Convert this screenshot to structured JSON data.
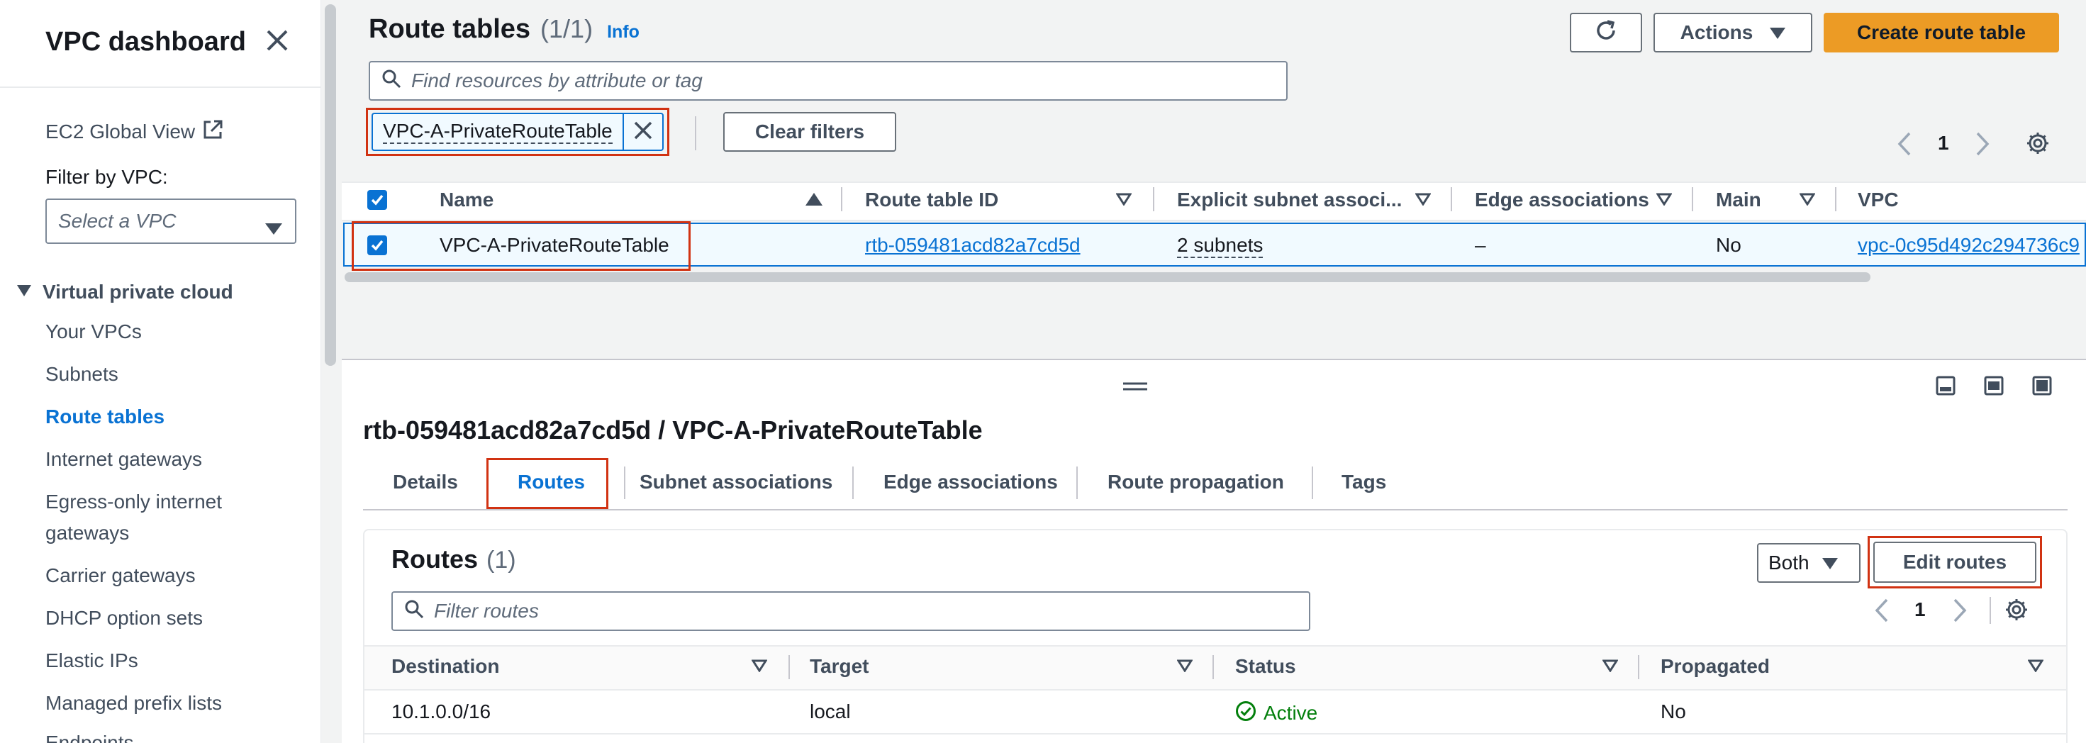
{
  "sidebar": {
    "title": "VPC dashboard",
    "ec2_global_view": "EC2 Global View",
    "filter_label": "Filter by VPC:",
    "filter_placeholder": "Select a VPC",
    "section_title": "Virtual private cloud",
    "items": [
      {
        "label": "Your VPCs"
      },
      {
        "label": "Subnets"
      },
      {
        "label": "Route tables",
        "active": true
      },
      {
        "label": "Internet gateways"
      },
      {
        "label": "Egress-only internet"
      },
      {
        "label": "gateways"
      },
      {
        "label": "Carrier gateways"
      },
      {
        "label": "DHCP option sets"
      },
      {
        "label": "Elastic IPs"
      },
      {
        "label": "Managed prefix lists"
      },
      {
        "label": "Endpoints"
      }
    ]
  },
  "header": {
    "title": "Route tables",
    "count": "(1/1)",
    "info": "Info",
    "actions_label": "Actions",
    "create_label": "Create route table"
  },
  "search": {
    "placeholder": "Find resources by attribute or tag",
    "filter_token": "VPC-A-PrivateRouteTable",
    "clear_filters": "Clear filters",
    "page": "1"
  },
  "table": {
    "columns": [
      "Name",
      "Route table ID",
      "Explicit subnet associ...",
      "Edge associations",
      "Main",
      "VPC"
    ],
    "row": {
      "name": "VPC-A-PrivateRouteTable",
      "route_table_id": "rtb-059481acd82a7cd5d",
      "explicit_subnet": "2 subnets",
      "edge_associations": "–",
      "main": "No",
      "vpc": "vpc-0c95d492c294736c9"
    }
  },
  "detail": {
    "title": "rtb-059481acd82a7cd5d / VPC-A-PrivateRouteTable",
    "tabs": [
      "Details",
      "Routes",
      "Subnet associations",
      "Edge associations",
      "Route propagation",
      "Tags"
    ],
    "active_tab": "Routes",
    "routes_title": "Routes",
    "routes_count": "(1)",
    "both_label": "Both",
    "edit_routes": "Edit routes",
    "filter_placeholder": "Filter routes",
    "page": "1",
    "columns": [
      "Destination",
      "Target",
      "Status",
      "Propagated"
    ],
    "routes": [
      {
        "destination": "10.1.0.0/16",
        "target": "local",
        "status": "Active",
        "propagated": "No"
      }
    ]
  },
  "colors": {
    "accent": "#0972d3",
    "primary_button": "#ec9b25",
    "highlight": "#d13212",
    "success": "#037f0c"
  }
}
